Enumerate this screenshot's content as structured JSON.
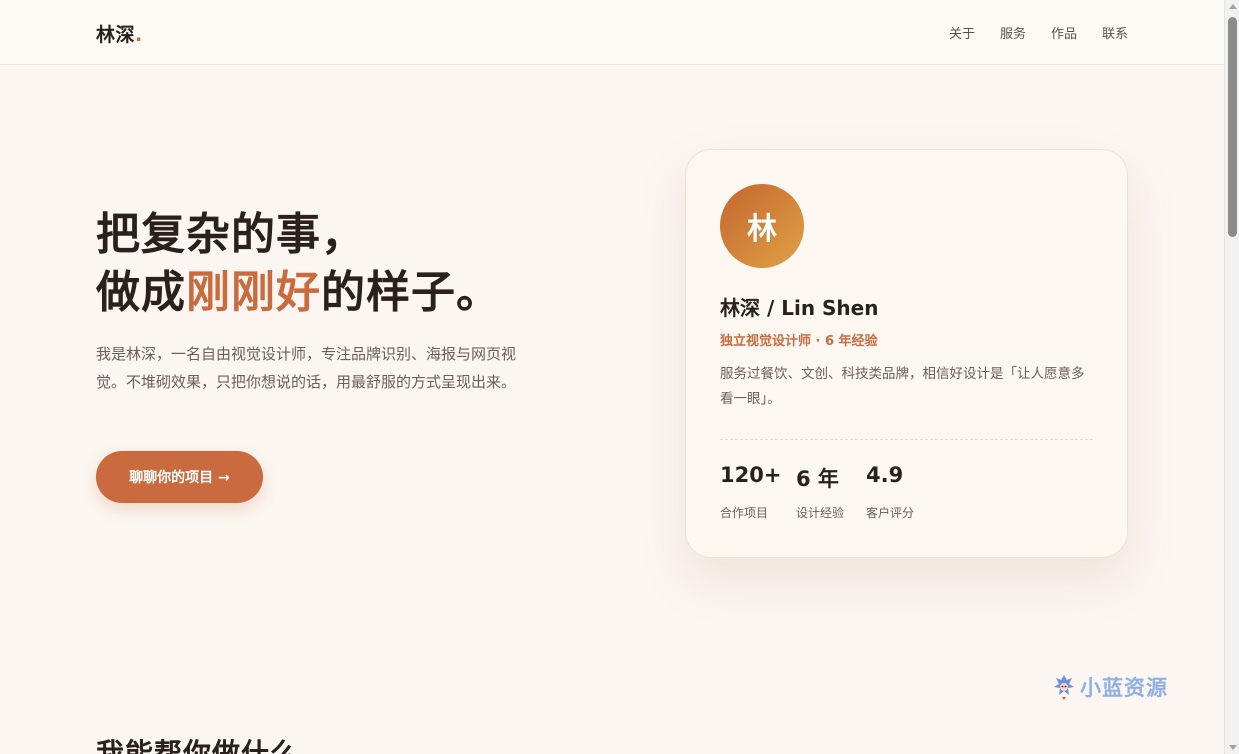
{
  "header": {
    "logo": "林深",
    "logo_dot": ".",
    "nav": [
      {
        "label": "关于"
      },
      {
        "label": "服务"
      },
      {
        "label": "作品"
      },
      {
        "label": "联系"
      }
    ]
  },
  "hero": {
    "title_line1": "把复杂的事，",
    "title_line2_before": "做成",
    "title_line2_accent": "刚刚好",
    "title_line2_after": "的样子。",
    "description": "我是林深，一名自由视觉设计师，专注品牌识别、海报与网页视觉。不堆砌效果，只把你想说的话，用最舒服的方式呈现出来。",
    "cta_label": "聊聊你的项目 →"
  },
  "card": {
    "avatar_text": "林",
    "name": "林深 / Lin Shen",
    "role": "独立视觉设计师 · 6 年经验",
    "description": "服务过餐饮、文创、科技类品牌，相信好设计是「让人愿意多看一眼」。",
    "stats": [
      {
        "value": "120+",
        "label": "合作项目"
      },
      {
        "value": "6 年",
        "label": "设计经验"
      },
      {
        "value": "4.9",
        "label": "客户评分"
      }
    ]
  },
  "section": {
    "title": "我能帮你做什么"
  },
  "watermark": {
    "text": "小蓝资源",
    "icon": "mascot-icon"
  },
  "colors": {
    "accent": "#c96a3f",
    "background": "#fbf6f1",
    "text": "#2a211c"
  }
}
